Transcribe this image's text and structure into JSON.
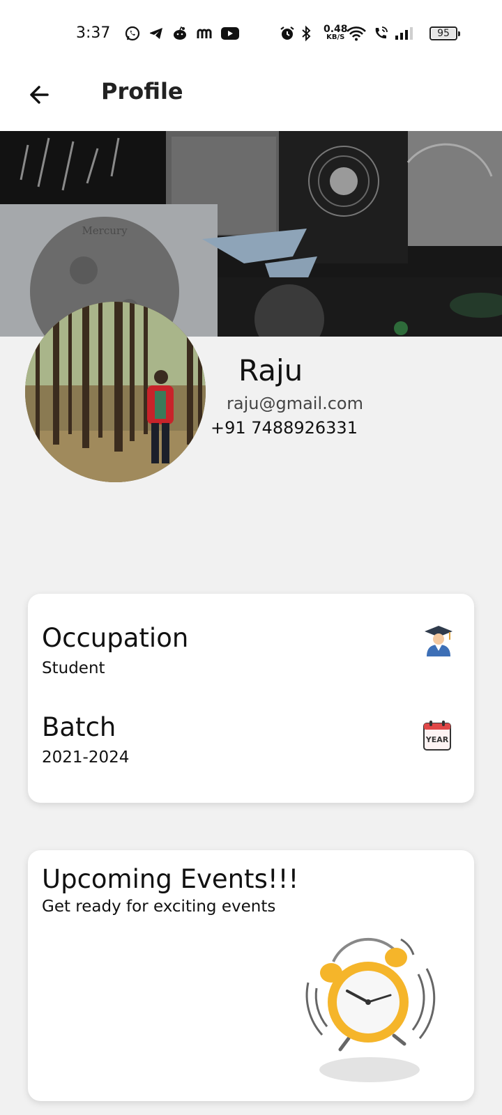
{
  "status_bar": {
    "time": "3:37",
    "net_speed_value": "0.48",
    "net_speed_unit": "KB/S",
    "battery": "95"
  },
  "app_bar": {
    "title": "Profile"
  },
  "profile": {
    "name": "Raju",
    "email": "raju@gmail.com",
    "phone": "+91 7488926331",
    "cover_text": "Mercury"
  },
  "info_card": {
    "occupation_label": "Occupation",
    "occupation_value": "Student",
    "batch_label": "Batch",
    "batch_value": "2021-2024",
    "calendar_text": "YEAR"
  },
  "events_card": {
    "title": "Upcoming Events!!!",
    "subtitle": "Get ready for exciting events"
  },
  "colors": {
    "background": "#f1f1f1",
    "card": "#ffffff",
    "clock_yellow": "#f5b52a"
  }
}
